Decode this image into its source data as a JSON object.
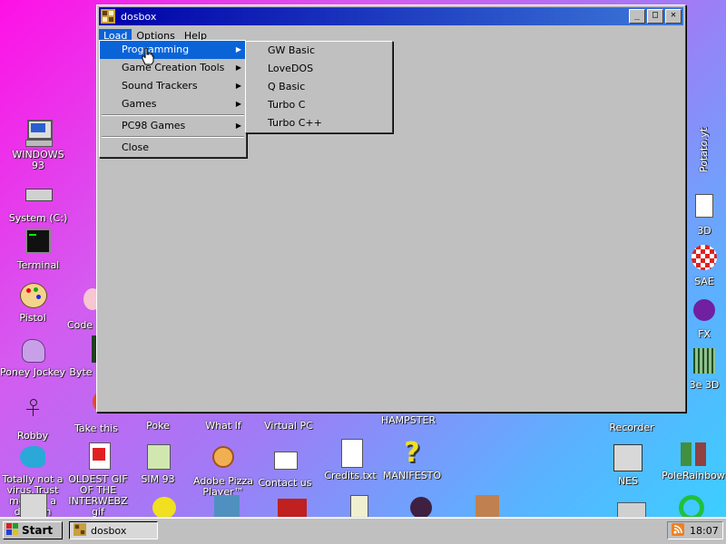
{
  "window": {
    "title": "dosbox",
    "controls": {
      "minimize": "_",
      "maximize": "□",
      "close": "✕"
    }
  },
  "menubar": {
    "items": [
      "Load",
      "Options",
      "Help"
    ]
  },
  "load_menu": {
    "items": [
      "Programming",
      "Game Creation Tools",
      "Sound Trackers",
      "Games",
      "PC98 Games",
      "Close"
    ]
  },
  "programming_submenu": {
    "items": [
      "GW Basic",
      "LoveDOS",
      "Q Basic",
      "Turbo C",
      "Turbo C++"
    ]
  },
  "desktop": {
    "left_icons": [
      "WINDOWS 93",
      "System (C:)",
      "Terminal",
      "Pistol",
      "Poney Jockey",
      "Robby",
      "Totally not a virus.Trust me...im a dolphin"
    ],
    "second_col": [
      "Code",
      "Byte",
      "Take this",
      "OLDEST GIF OF THE INTERWEBZ gif"
    ],
    "bottom_row": [
      "Poke",
      "SIM 93",
      "What If",
      "Adobe Pizza Player™",
      "Virtual PC",
      "Contact us",
      "Credits.txt",
      "HAMPSTER",
      "MANIFESTO"
    ],
    "right_icons": [
      "Potato.yt",
      "3D",
      "SAE",
      "FX",
      "3e 3D",
      "Recorder",
      "NES",
      "PoleRainbow"
    ]
  },
  "taskbar": {
    "start_label": "Start",
    "task_label": "dosbox",
    "clock": "18:07"
  }
}
